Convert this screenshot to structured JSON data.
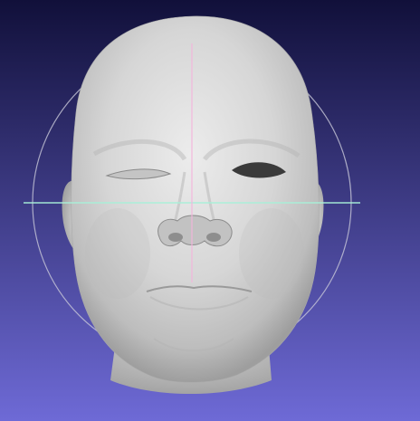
{
  "viewer": {
    "background": {
      "top_color": "#11103a",
      "bottom_color": "#6e6ad6"
    },
    "model": {
      "name": "face-mesh",
      "shading": "flat-grey",
      "base_color": "#cfcfcf",
      "eye_hole_color": "#3a3a3a"
    },
    "trackball": {
      "visible": true,
      "circle_color": "#c8c8d8",
      "horizontal_axis_color": "#a8f0d8",
      "vertical_axis_color": "#f4b4dc"
    }
  }
}
